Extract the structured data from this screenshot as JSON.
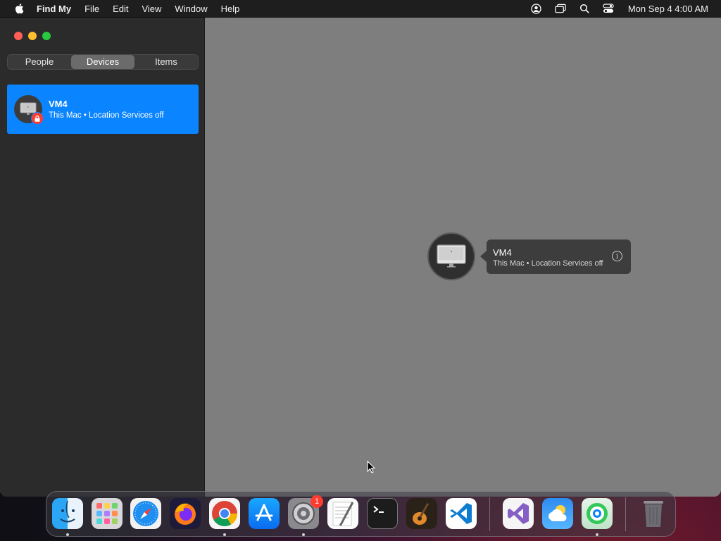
{
  "menubar": {
    "app_name": "Find My",
    "menus": [
      "File",
      "Edit",
      "View",
      "Window",
      "Help"
    ],
    "clock": "Mon Sep 4  4:00 AM",
    "status_icons": [
      "user-account-icon",
      "screen-mirroring-icon",
      "spotlight-search-icon",
      "control-center-icon"
    ]
  },
  "sidebar": {
    "tabs": [
      {
        "label": "People"
      },
      {
        "label": "Devices"
      },
      {
        "label": "Items"
      }
    ],
    "active_tab": "Devices",
    "devices": [
      {
        "name": "VM4",
        "subtitle": "This Mac • Location Services off",
        "locked": true
      }
    ]
  },
  "map": {
    "callout": {
      "name": "VM4",
      "subtitle": "This Mac • Location Services off",
      "info_glyph": "i"
    }
  },
  "dock": {
    "apps": [
      "Finder",
      "Launchpad",
      "Safari",
      "Firefox",
      "Google Chrome",
      "App Store",
      "System Settings",
      "TextEdit",
      "Terminal",
      "GarageBand",
      "Visual Studio Code",
      "Visual Studio",
      "Weather",
      "Find My",
      "Trash"
    ],
    "system_settings_badge": "1"
  },
  "colors": {
    "accent": "#0a84ff",
    "sidebar_bg": "#2b2b2b",
    "map_bg": "#7e7e7e"
  }
}
